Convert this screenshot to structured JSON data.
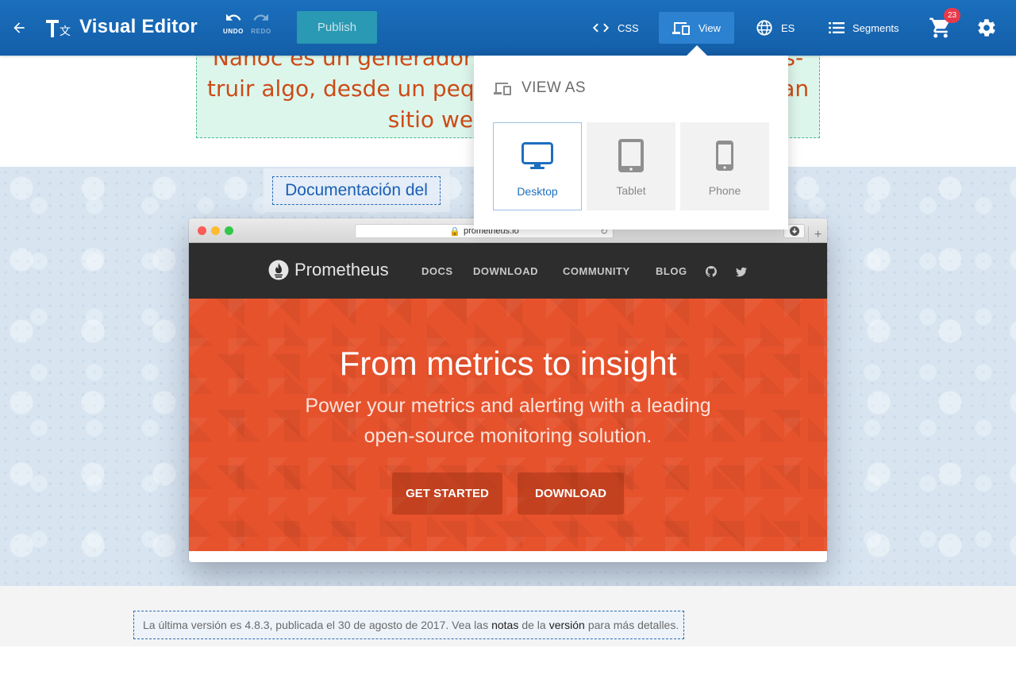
{
  "toolbar": {
    "title": "Visual Editor",
    "undo_label": "UNDO",
    "redo_label": "REDO",
    "publish_label": "Publish",
    "css_label": "CSS",
    "view_label": "View",
    "language_label": "ES",
    "segments_label": "Segments",
    "cart_count": "23",
    "accent_color": "#1a6fbd"
  },
  "view_menu": {
    "header": "VIEW AS",
    "options": [
      {
        "label": "Desktop",
        "icon": "desktop-icon",
        "selected": true
      },
      {
        "label": "Tablet",
        "icon": "tablet-icon",
        "selected": false
      },
      {
        "label": "Phone",
        "icon": "phone-icon",
        "selected": false
      }
    ]
  },
  "content": {
    "intro_lines": [
      "Nanoc es un generador de sitios estáticos para cons-",
      "truir algo, desde un pequeño blog personal, a un gran",
      "sitio web corporativo."
    ],
    "doc_link": "Documentación del",
    "release_note": {
      "prefix": "La última versión es 4.8.3, publicada el 30 de agosto de 2017. Vea las",
      "link1": "notas",
      "middle": "de la",
      "link2": "versión",
      "suffix": "para más detalles."
    }
  },
  "embedded_site": {
    "url": "prometheus.io",
    "brand": "Prometheus",
    "nav": [
      "DOCS",
      "DOWNLOAD",
      "COMMUNITY",
      "BLOG"
    ],
    "hero_title": "From metrics to insight",
    "hero_subtitle_1": "Power your metrics and alerting with a leading",
    "hero_subtitle_2": "open-source monitoring solution.",
    "cta_primary": "GET STARTED",
    "cta_secondary": "DOWNLOAD",
    "brand_color": "#e6522c"
  }
}
